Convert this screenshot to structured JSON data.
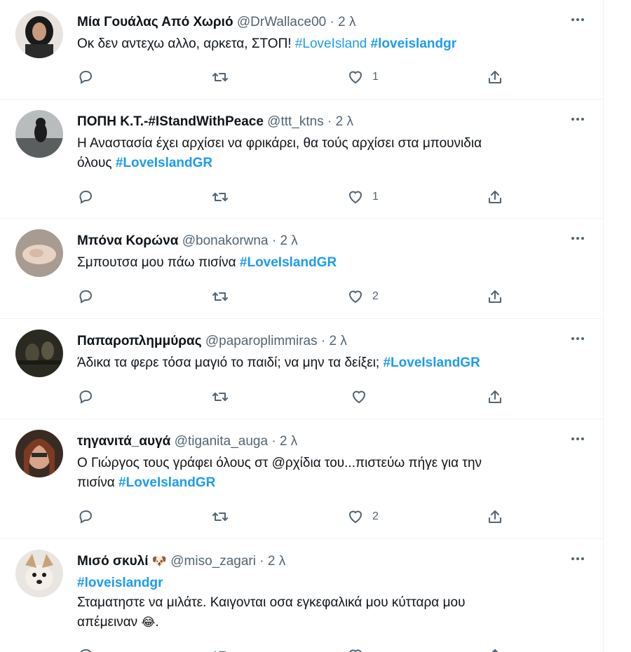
{
  "colors": {
    "link": "#1d9bf0",
    "text": "#0f1419",
    "muted": "#536471"
  },
  "tweets": [
    {
      "name": "Μία Γουάλας Από Χωριό",
      "handle": "@DrWallace00",
      "dot": "·",
      "time": "2 λ",
      "body1": "Οκ δεν αντεχω αλλο, αρκετα, ΣΤΟΠ!",
      "tag1": "#LoveIsland",
      "tag2": "#loveislandgr",
      "likes": "1"
    },
    {
      "name": "ΠΟΠΗ Κ.Τ.-#IStandWithPeace",
      "handle": "@ttt_ktns",
      "dot": "·",
      "time": "2 λ",
      "body1": "Η Αναστασία έχει αρχίσει να φρικάρει, θα τούς αρχίσει στα μπουνιδια",
      "body2": "όλους",
      "tag1": "#LoveIslandGR",
      "likes": "1"
    },
    {
      "name": "Μπόνα Κορώνα",
      "handle": "@bonakorwna",
      "dot": "·",
      "time": "2 λ",
      "body1": "Σμπουτσα μου πάω πισίνα",
      "tag1": "#LoveIslandGR",
      "likes": "2"
    },
    {
      "name": "Παπαροπλημμύρας",
      "handle": "@paparoplimmiras",
      "dot": "·",
      "time": "2 λ",
      "body1": "Άδικα τα φερε τόσα μαγιό το παιδί; να μην τα δείξει;",
      "tag1": "#LoveIslandGR",
      "likes": ""
    },
    {
      "name": "τηγανιτά_αυγά",
      "handle": "@tiganita_auga",
      "dot": "·",
      "time": "2 λ",
      "body1": "Ο Γιώργος τους γράφει όλους στ @ρχίδια του...πιστεύω πήγε για την",
      "body2": "πισίνα",
      "tag1": "#LoveIslandGR",
      "likes": "2"
    },
    {
      "name": "Μισό σκυλί",
      "name_emoji": "🐶",
      "handle": "@miso_zagari",
      "dot": "·",
      "time": "2 λ",
      "tag1": "#loveislandgr",
      "body1": "Σταματηστε να μιλάτε. Καιγονται οσα εγκεφαλικά μου κύτταρα μου",
      "body2": "απέμειναν",
      "body_emoji": "😂",
      "body_end": "."
    }
  ]
}
